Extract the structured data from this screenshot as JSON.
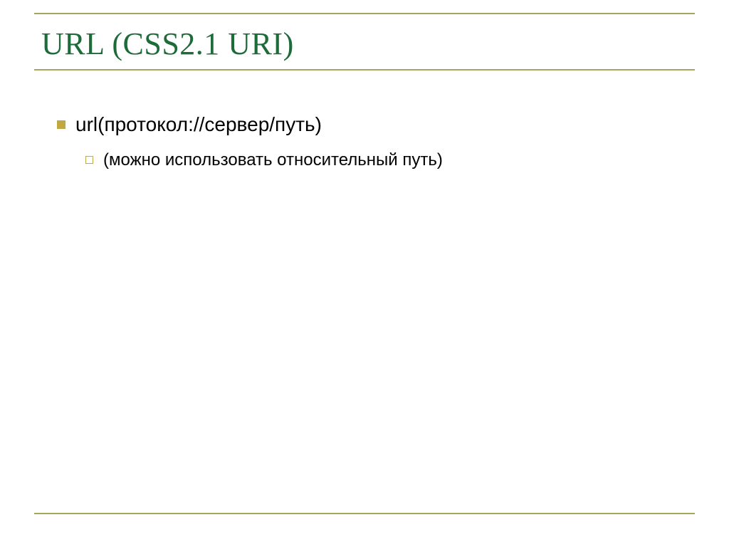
{
  "title": "URL (CSS2.1 URI)",
  "bullets": {
    "level1": "url(протокол://сервер/путь)",
    "level2": "(можно использовать относительный путь)"
  }
}
